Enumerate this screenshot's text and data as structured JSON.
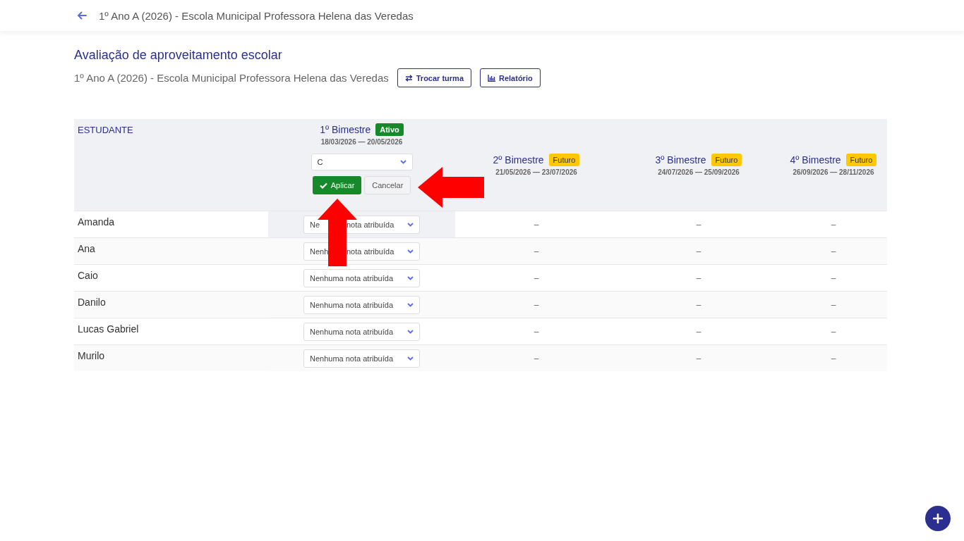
{
  "header": {
    "title": "1º Ano A (2026) - Escola Municipal Professora Helena das Veredas"
  },
  "page": {
    "title": "Avaliação de aproveitamento escolar",
    "subtitle": "1º Ano A (2026) - Escola Municipal Professora Helena das Veredas",
    "actions": [
      {
        "label": "Trocar turma"
      },
      {
        "label": "Relatório"
      }
    ]
  },
  "table": {
    "student_column": "ESTUDANTE",
    "periods": [
      {
        "name": "1º Bimestre",
        "badge": "Ativo",
        "kind": "active",
        "dates": "18/03/2026 — 20/05/2026",
        "bulk": {
          "value": "C",
          "apply": "Aplicar",
          "cancel": "Cancelar"
        }
      },
      {
        "name": "2º Bimestre",
        "badge": "Futuro",
        "kind": "future",
        "dates": "21/05/2026 — 23/07/2026"
      },
      {
        "name": "3º Bimestre",
        "badge": "Futuro",
        "kind": "future",
        "dates": "24/07/2026 — 25/09/2026"
      },
      {
        "name": "4º Bimestre",
        "badge": "Futuro",
        "kind": "future",
        "dates": "26/09/2026 — 28/11/2026"
      }
    ],
    "rows": [
      {
        "name": "Amanda",
        "grades": [
          {
            "kind": "covered-select",
            "visible_start": "Ne",
            "value": "nota atribuída"
          },
          {
            "kind": "empty",
            "text": "–"
          },
          {
            "kind": "empty",
            "text": "–"
          },
          {
            "kind": "empty",
            "text": "–"
          }
        ]
      },
      {
        "name": "Ana",
        "grades": [
          {
            "kind": "covered-select",
            "visible_start": "Nenh",
            "value": "nota atribuída"
          },
          {
            "kind": "empty",
            "text": "–"
          },
          {
            "kind": "empty",
            "text": "–"
          },
          {
            "kind": "empty",
            "text": "–"
          }
        ]
      },
      {
        "name": "Caio",
        "grades": [
          {
            "kind": "select",
            "value": "Nenhuma nota atribuída"
          },
          {
            "kind": "empty",
            "text": "–"
          },
          {
            "kind": "empty",
            "text": "–"
          },
          {
            "kind": "empty",
            "text": "–"
          }
        ]
      },
      {
        "name": "Danilo",
        "grades": [
          {
            "kind": "select",
            "value": "Nenhuma nota atribuída"
          },
          {
            "kind": "empty",
            "text": "–"
          },
          {
            "kind": "empty",
            "text": "–"
          },
          {
            "kind": "empty",
            "text": "–"
          }
        ]
      },
      {
        "name": "Lucas Gabriel",
        "grades": [
          {
            "kind": "select",
            "value": "Nenhuma nota atribuída"
          },
          {
            "kind": "empty",
            "text": "–"
          },
          {
            "kind": "empty",
            "text": "–"
          },
          {
            "kind": "empty",
            "text": "–"
          }
        ]
      },
      {
        "name": "Murilo",
        "grades": [
          {
            "kind": "select",
            "value": "Nenhuma nota atribuída"
          },
          {
            "kind": "empty",
            "text": "–"
          },
          {
            "kind": "empty",
            "text": "–"
          },
          {
            "kind": "empty",
            "text": "–"
          }
        ]
      }
    ]
  }
}
